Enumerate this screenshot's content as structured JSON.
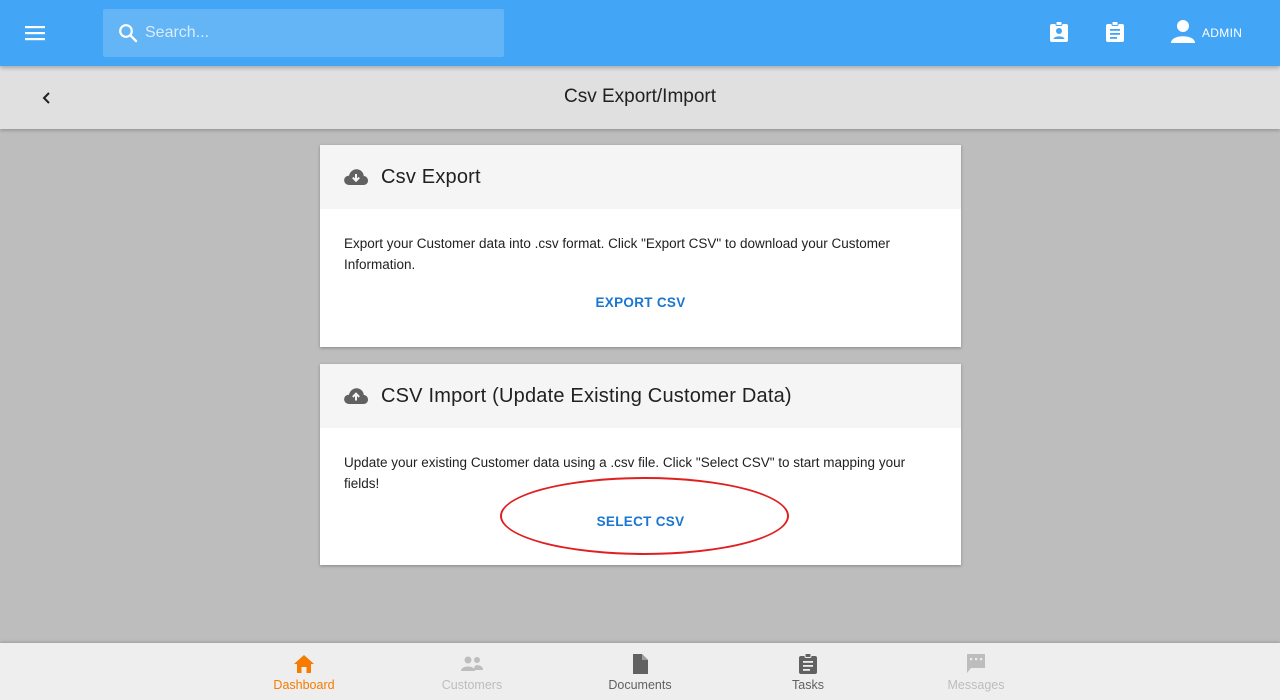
{
  "colors": {
    "appbar": "#42a5f5",
    "search_bg": "#64b5f6",
    "accent_link": "#1976d2",
    "nav_active": "#f57c00",
    "nav_inactive": "#bdbdbd",
    "nav_default": "#616161",
    "annotation": "#e02020"
  },
  "topbar": {
    "menu_icon": "hamburger-menu-icon",
    "search": {
      "placeholder": "Search...",
      "value": "",
      "icon": "search-icon"
    },
    "actions": [
      {
        "icon": "contact-card-icon"
      },
      {
        "icon": "clipboard-icon"
      }
    ],
    "user": {
      "icon": "person-icon",
      "label": "ADMIN"
    }
  },
  "subheader": {
    "back_icon": "chevron-left-icon",
    "title": "Csv Export/Import"
  },
  "cards": {
    "export": {
      "icon": "cloud-download-icon",
      "title": "Csv Export",
      "description": "Export your Customer data into .csv format. Click \"Export CSV\" to download your Customer Information.",
      "action_label": "EXPORT CSV"
    },
    "import": {
      "icon": "cloud-upload-icon",
      "title": "CSV Import (Update Existing Customer Data)",
      "description": "Update your existing Customer data using a .csv file. Click \"Select CSV\" to start mapping your fields!",
      "action_label": "SELECT CSV"
    }
  },
  "bottom_nav": {
    "items": [
      {
        "label": "Dashboard",
        "icon": "home-icon",
        "state": "active"
      },
      {
        "label": "Customers",
        "icon": "people-icon",
        "state": "disabled"
      },
      {
        "label": "Documents",
        "icon": "document-icon",
        "state": "default"
      },
      {
        "label": "Tasks",
        "icon": "clipboard-icon",
        "state": "default"
      },
      {
        "label": "Messages",
        "icon": "message-icon",
        "state": "disabled"
      }
    ]
  }
}
